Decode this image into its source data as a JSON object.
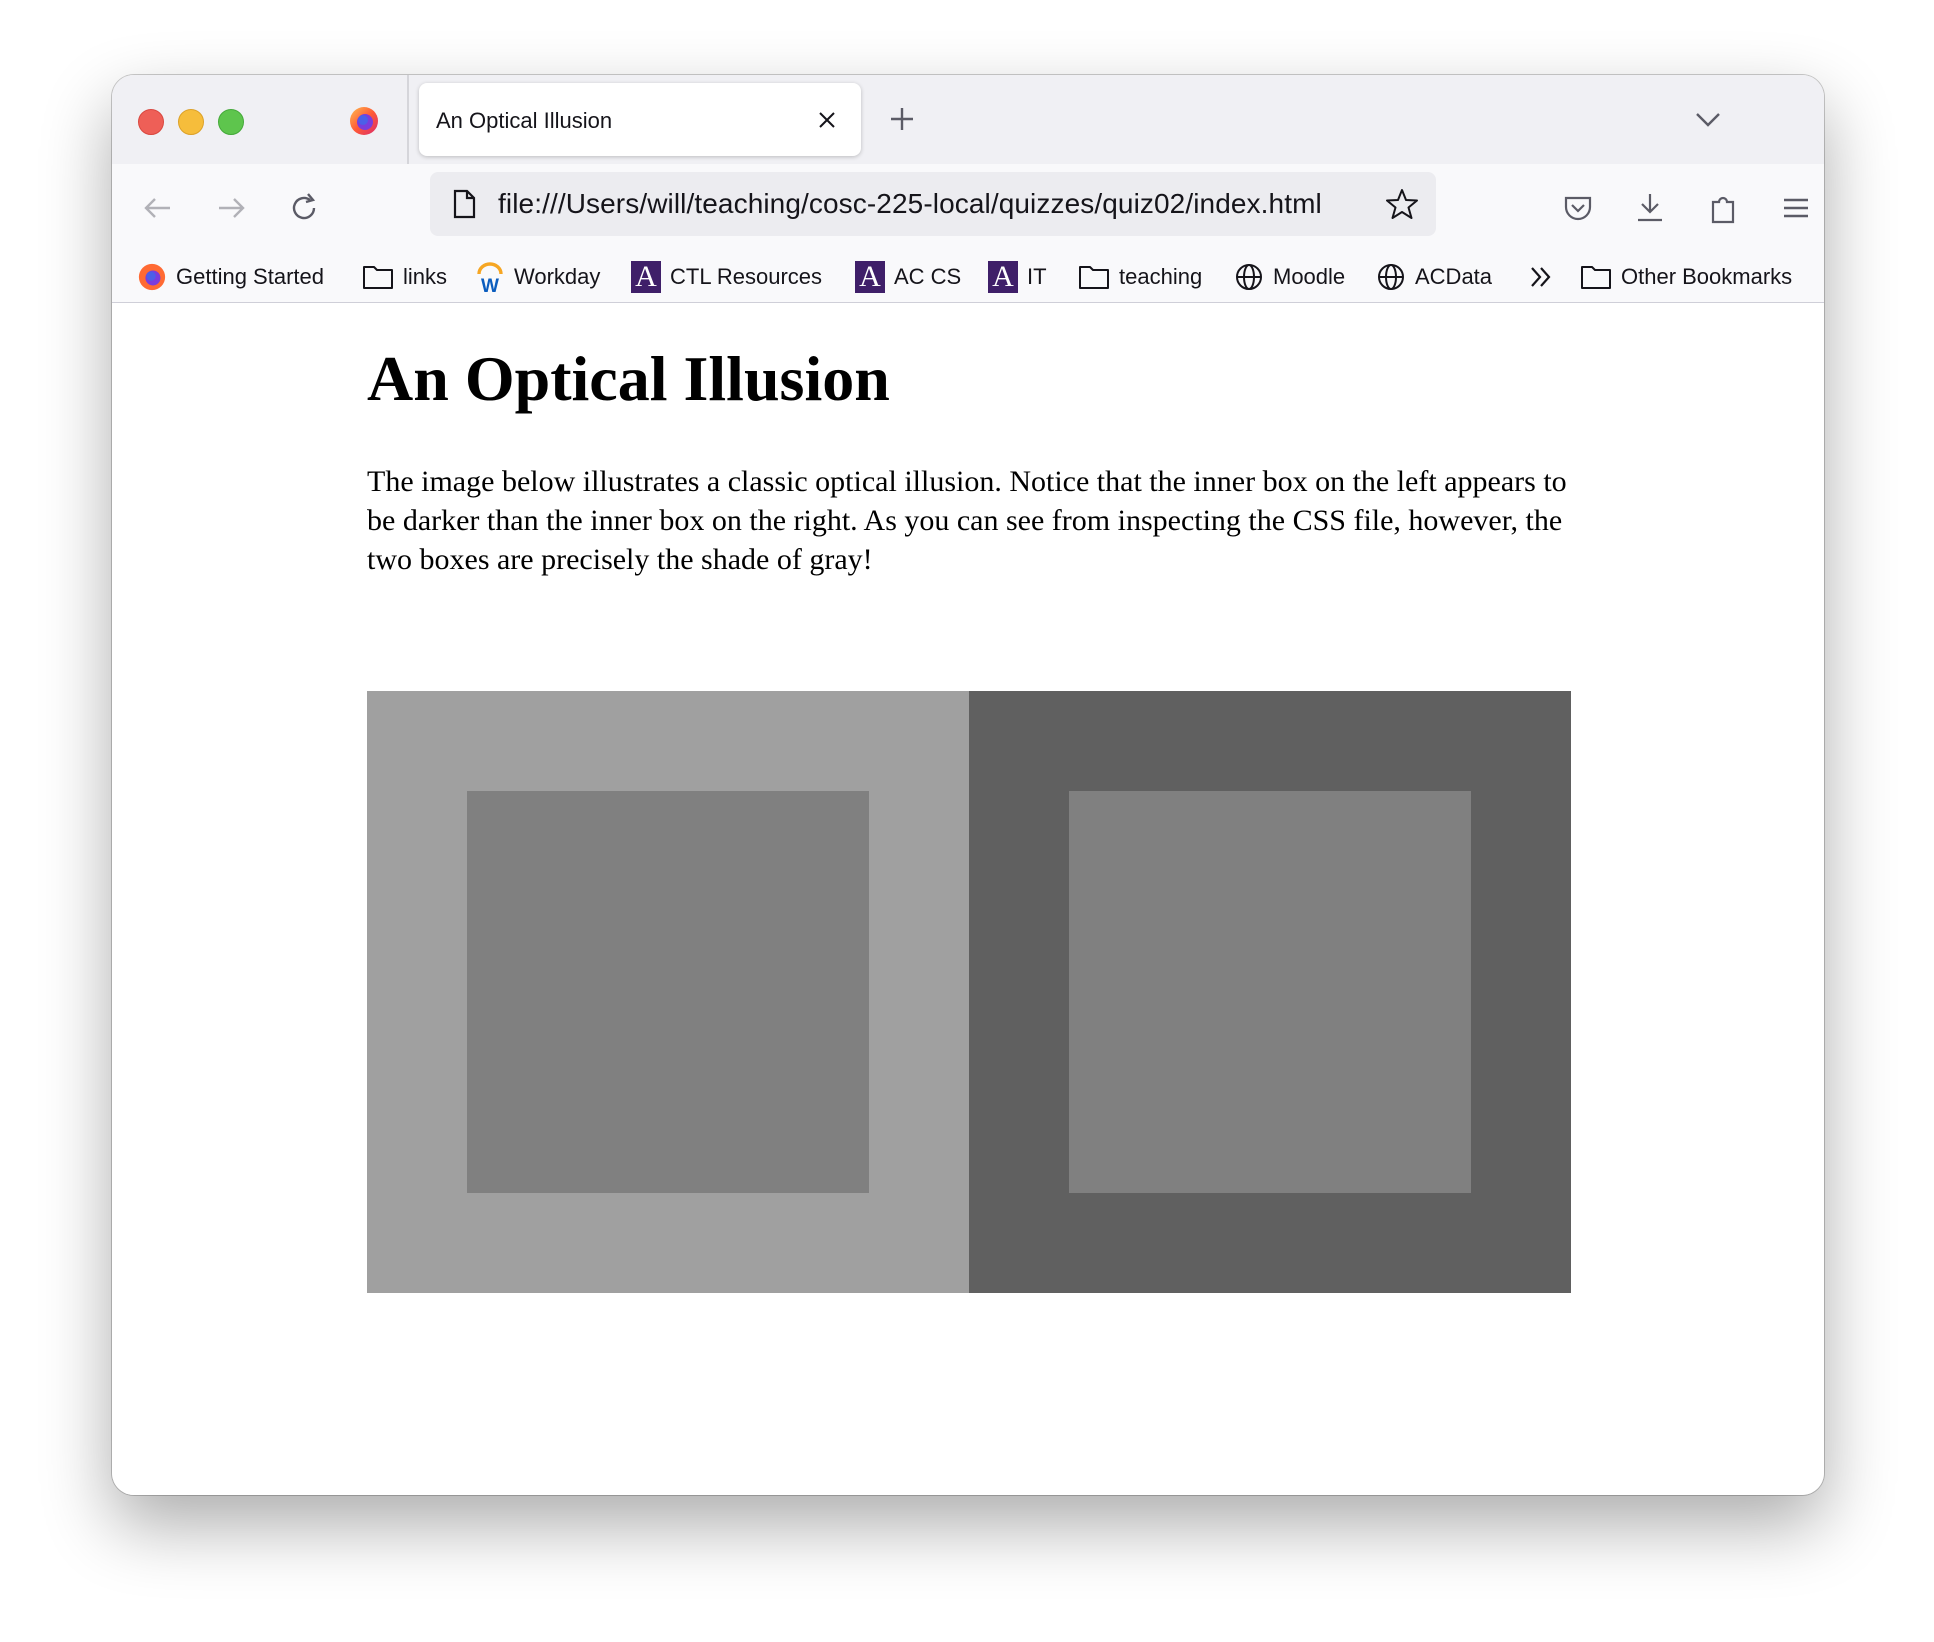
{
  "browser": {
    "tab_title": "An Optical Illusion",
    "url": "file:///Users/will/teaching/cosc-225-local/quizzes/quiz02/index.html",
    "bookmarks": [
      {
        "label": "Getting Started",
        "icon": "firefox-icon"
      },
      {
        "label": "links",
        "icon": "folder-icon"
      },
      {
        "label": "Workday",
        "icon": "workday-icon"
      },
      {
        "label": "CTL Resources",
        "icon": "amherst-icon"
      },
      {
        "label": "AC CS",
        "icon": "amherst-icon"
      },
      {
        "label": "IT",
        "icon": "amherst-icon"
      },
      {
        "label": "teaching",
        "icon": "folder-icon"
      },
      {
        "label": "Moodle",
        "icon": "globe-icon"
      },
      {
        "label": "ACData",
        "icon": "globe-icon"
      }
    ],
    "other_bookmarks": "Other Bookmarks"
  },
  "page": {
    "title": "An Optical Illusion",
    "description": "The image below illustrates a classic optical illusion. Notice that the inner box on the left appears to be darker than the inner box on the right. As you can see from inspecting the CSS file, however, the two boxes are precisely the shade of gray!"
  },
  "illusion": {
    "left_outer_color": "#a0a0a0",
    "right_outer_color": "#606060",
    "inner_color": "#808080"
  },
  "colors": {
    "amherst_purple": "#3f1f69",
    "tabbar_bg": "#f0f0f4",
    "toolbar_bg": "#f9f9fb"
  }
}
